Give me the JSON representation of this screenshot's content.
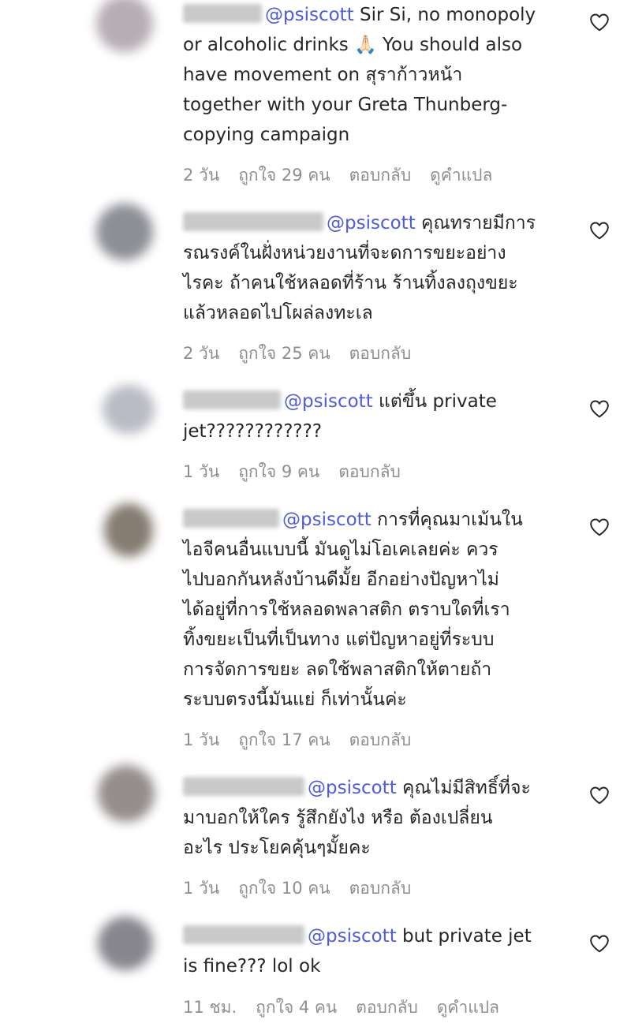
{
  "comments": [
    {
      "mention": "@psiscott",
      "lines": [
        "Sir Si, no monopoly",
        "or alcoholic drinks 🙏🏻 You should also",
        "have movement on สุราก้าวหน้า",
        "together with your Greta Thunberg-",
        "copying campaign"
      ],
      "time": "2 วัน",
      "likes": "ถูกใจ 29 คน",
      "reply": "ตอบกลับ",
      "translate": "ดูคำแปล"
    },
    {
      "mention": "@psiscott",
      "lines": [
        "คุณทรายมีการ",
        "รณรงค์ในฝั่งหน่วยงานที่จะดการขยะอย่าง",
        "ไรคะ ถ้าคนใช้หลอดที่ร้าน ร้านทิ้งลงถุงขยะ",
        "แล้วหลอดไปโผล่ลงทะเล"
      ],
      "time": "2 วัน",
      "likes": "ถูกใจ 25 คน",
      "reply": "ตอบกลับ"
    },
    {
      "mention": "@psiscott",
      "lines": [
        "แต่ขึ้น private",
        "jet????????????"
      ],
      "time": "1 วัน",
      "likes": "ถูกใจ 9 คน",
      "reply": "ตอบกลับ"
    },
    {
      "mention": "@psiscott",
      "lines": [
        "การที่คุณมาเม้นใน",
        "ไอจีคนอื่นแบบนี้ มันดูไม่โอเคเลยค่ะ ควร",
        "ไปบอกกันหลังบ้านดีมั้ย อีกอย่างปัญหาไม่",
        "ได้อยู่ที่การใช้หลอดพลาสติก ตราบใดที่เรา",
        "ทิ้งขยะเป็นที่เป็นทาง แต่ปัญหาอยู่ที่ระบบ",
        "การจัดการขยะ ลดใช้พลาสติกให้ตายถ้า",
        "ระบบตรงนี้มันแย่ ก็เท่านั้นค่ะ"
      ],
      "time": "1 วัน",
      "likes": "ถูกใจ 17 คน",
      "reply": "ตอบกลับ"
    },
    {
      "mention": "@psiscott",
      "lines": [
        "คุณไม่มีสิทธิ์ที่จะ",
        "มาบอกให้ใคร รู้สึกยังไง หรือ ต้องเปลี่ยน",
        "อะไร ประโยคคุ้นๆมั้ยคะ"
      ],
      "time": "1 วัน",
      "likes": "ถูกใจ 10 คน",
      "reply": "ตอบกลับ"
    },
    {
      "mention": "@psiscott",
      "lines": [
        "but private jet",
        "is fine??? lol ok"
      ],
      "time": "11 ชม.",
      "likes": "ถูกใจ 4 คน",
      "reply": "ตอบกลับ",
      "translate": "ดูคำแปล"
    }
  ],
  "colors": {
    "mention": "#4e5be0",
    "meta": "#8e8e8e",
    "text": "#262626"
  },
  "icons": {
    "like": "heart-outline-icon"
  }
}
